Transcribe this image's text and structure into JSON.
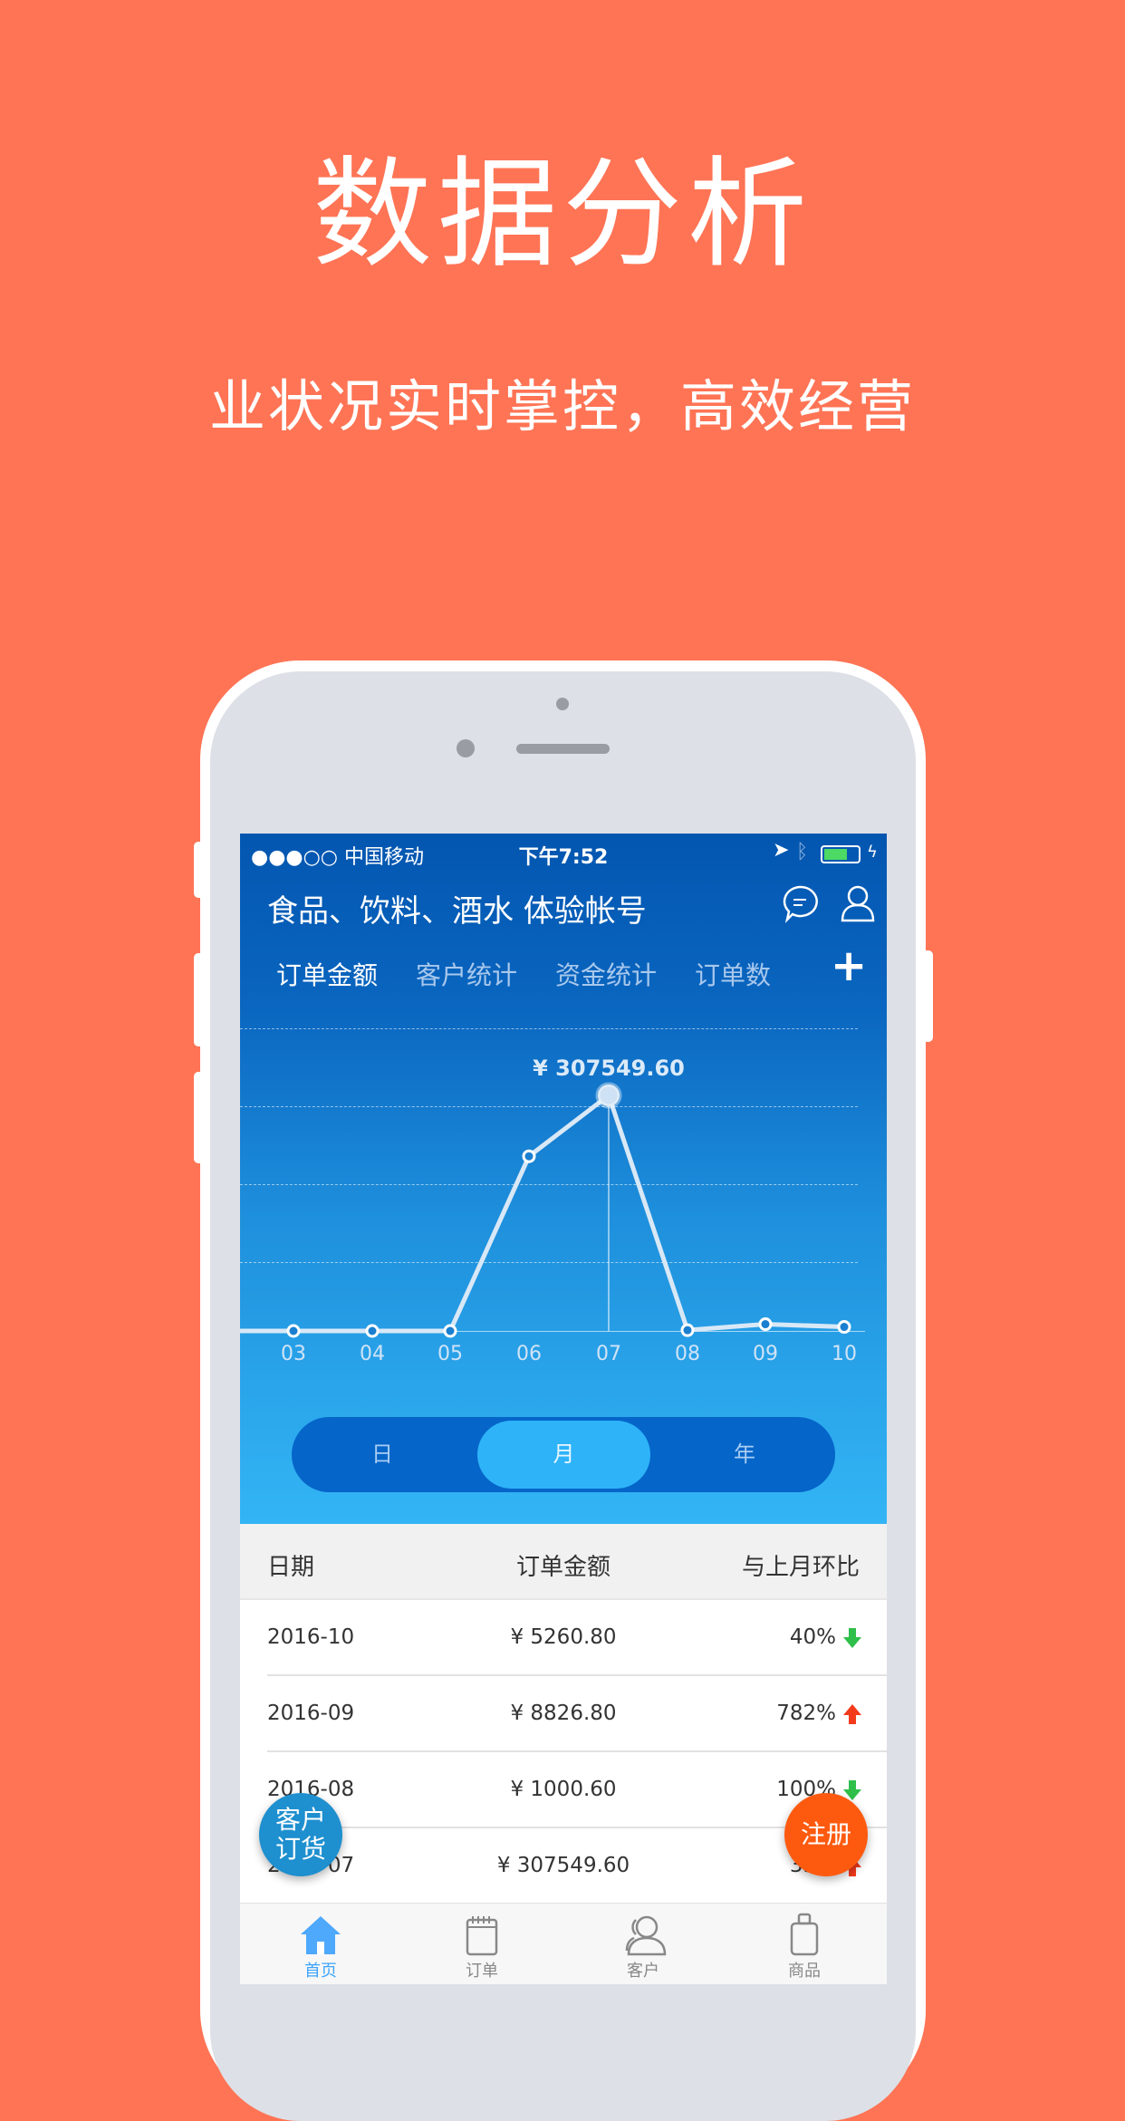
{
  "promo": {
    "title": "数据分析",
    "subtitle": "业状况实时掌控，高效经营"
  },
  "status_bar": {
    "carrier": "●●●○○ 中国移动",
    "time": "下午7:52",
    "battery_color": "#4cd964"
  },
  "header": {
    "title": "食品、饮料、酒水 体验帐号",
    "icons": [
      "chat-icon",
      "user-icon"
    ]
  },
  "tabs": [
    {
      "label": "订单金额",
      "active": true
    },
    {
      "label": "客户统计"
    },
    {
      "label": "资金统计"
    },
    {
      "label": "订单数"
    }
  ],
  "add_label": "+",
  "chart_data": {
    "type": "line",
    "categories": [
      "03",
      "04",
      "05",
      "06",
      "07",
      "08",
      "09",
      "10"
    ],
    "values": [
      0,
      0,
      0,
      228000,
      307549.6,
      1000.6,
      8826.8,
      5260.8
    ],
    "highlight": {
      "category": "07",
      "label": "¥ 307549.60"
    },
    "ylim": [
      0,
      395000
    ],
    "grid": true
  },
  "period": {
    "options": [
      "日",
      "月",
      "年"
    ],
    "selected": "月"
  },
  "table": {
    "headers": [
      "日期",
      "订单金额",
      "与上月环比"
    ],
    "rows": [
      {
        "date": "2016-10",
        "amount": "¥ 5260.80",
        "ratio": "40%",
        "trend": "down"
      },
      {
        "date": "2016-09",
        "amount": "¥ 8826.80",
        "ratio": "782%",
        "trend": "up"
      },
      {
        "date": "2016-08",
        "amount": "¥ 1000.60",
        "ratio": "100%",
        "trend": "down"
      },
      {
        "date": "2016-07",
        "amount": "¥ 307549.60",
        "ratio": "35%",
        "trend": "up"
      }
    ],
    "colors": {
      "up": "#f33b1c",
      "down": "#2fbf4a"
    }
  },
  "fab": {
    "left": "客户\n订货",
    "right": "注册"
  },
  "tabbar": [
    {
      "label": "首页",
      "active": true
    },
    {
      "label": "订单"
    },
    {
      "label": "客户"
    },
    {
      "label": "商品"
    }
  ]
}
